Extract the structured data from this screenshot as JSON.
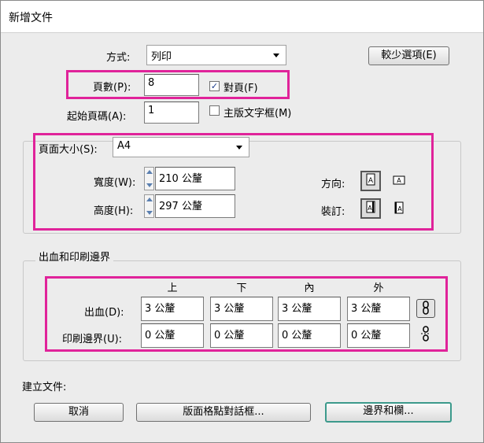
{
  "window": {
    "title": "新增文件"
  },
  "intent": {
    "label": "方式:",
    "value": "列印"
  },
  "fewer_options_button": "較少選項(E)",
  "pages": {
    "label": "頁數(P):",
    "value": "8"
  },
  "facing_pages": {
    "label": "對頁(F)",
    "checked": true
  },
  "start_page": {
    "label": "起始頁碼(A):",
    "value": "1"
  },
  "master_text_frame": {
    "label": "主版文字框(M)",
    "checked": false
  },
  "page_size": {
    "label": "頁面大小(S):",
    "value": "A4",
    "width_label": "寬度(W):",
    "width_value": "210 公釐",
    "height_label": "高度(H):",
    "height_value": "297 公釐",
    "orientation_label": "方向:",
    "binding_label": "裝訂:"
  },
  "bleed_slug": {
    "group_title": "出血和印刷邊界",
    "columns": [
      "上",
      "下",
      "內",
      "外"
    ],
    "bleed_label": "出血(D):",
    "bleed_values": [
      "3 公釐",
      "3 公釐",
      "3 公釐",
      "3 公釐"
    ],
    "slug_label": "印刷邊界(U):",
    "slug_values": [
      "0 公釐",
      "0 公釐",
      "0 公釐",
      "0 公釐"
    ]
  },
  "create_document_label": "建立文件:",
  "buttons": {
    "cancel": "取消",
    "layout_grid": "版面格點對話框...",
    "margins_columns": "邊界和欄..."
  },
  "colors": {
    "highlight": "#e0239a",
    "default_button_border": "#3c9a8c"
  }
}
